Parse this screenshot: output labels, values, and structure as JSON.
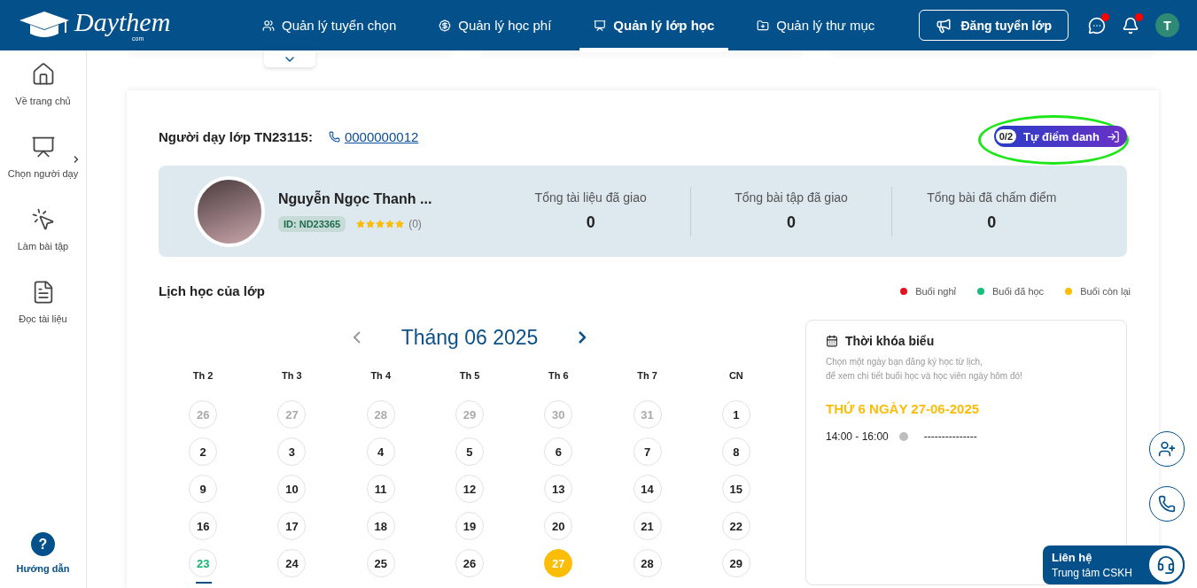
{
  "logo": {
    "name": "Daythem",
    "suffix": "com"
  },
  "nav": [
    {
      "label": "Quản lý tuyển chọn",
      "selected": false
    },
    {
      "label": "Quản lý học phí",
      "selected": false
    },
    {
      "label": "Quản lý lớp học",
      "selected": true
    },
    {
      "label": "Quản lý thư mục",
      "selected": false
    }
  ],
  "post_button": "Đăng tuyển lớp",
  "header_icons": [
    {
      "unread": true
    },
    {
      "unread": true
    }
  ],
  "user_initial": "T",
  "sidebar": {
    "items": [
      {
        "label": "Về trang chủ",
        "expandable": false
      },
      {
        "label": "Chọn người dạy",
        "expandable": true
      },
      {
        "label": "Làm bài tập",
        "expandable": false
      },
      {
        "label": "Đọc tài liệu",
        "expandable": false
      }
    ],
    "help": {
      "mark": "?",
      "label": "Hướng dẫn"
    }
  },
  "class_header": {
    "title": "Người dạy lớp TN23115:",
    "phone": "0000000012",
    "attendance": {
      "count": "0/2",
      "label": "Tự điểm danh",
      "highlighted": true
    }
  },
  "teacher": {
    "name": "Nguyễn Ngọc Thanh ...",
    "id": "ID: ND23365",
    "stars": 5,
    "reviews": "(0)",
    "stats": [
      {
        "label": "Tổng tài liệu đã giao",
        "value": "0"
      },
      {
        "label": "Tổng bài tập đã giao",
        "value": "0"
      },
      {
        "label": "Tổng bài đã chấm điểm",
        "value": "0"
      }
    ]
  },
  "schedule": {
    "title": "Lịch học của lớp",
    "legend": [
      {
        "label": "Buổi nghỉ",
        "color": "#e0161c"
      },
      {
        "label": "Buổi đã học",
        "color": "#12c07a"
      },
      {
        "label": "Buổi còn lại",
        "color": "#fbbd08"
      }
    ],
    "month": "Tháng 06 2025",
    "weekdays": [
      "Th 2",
      "Th 3",
      "Th 4",
      "Th 5",
      "Th 6",
      "Th 7",
      "CN"
    ],
    "days": [
      {
        "label": "26",
        "kind": "outside",
        "selected": false
      },
      {
        "label": "27",
        "kind": "outside",
        "selected": false
      },
      {
        "label": "28",
        "kind": "outside",
        "selected": false
      },
      {
        "label": "29",
        "kind": "outside",
        "selected": false
      },
      {
        "label": "30",
        "kind": "outside",
        "selected": false
      },
      {
        "label": "31",
        "kind": "outside",
        "selected": false
      },
      {
        "label": "1",
        "kind": "normal",
        "selected": false
      },
      {
        "label": "2",
        "kind": "normal",
        "selected": false
      },
      {
        "label": "3",
        "kind": "normal",
        "selected": false
      },
      {
        "label": "4",
        "kind": "normal",
        "selected": false
      },
      {
        "label": "5",
        "kind": "normal",
        "selected": false
      },
      {
        "label": "6",
        "kind": "normal",
        "selected": false
      },
      {
        "label": "7",
        "kind": "normal",
        "selected": false
      },
      {
        "label": "8",
        "kind": "normal",
        "selected": false
      },
      {
        "label": "9",
        "kind": "normal",
        "selected": false
      },
      {
        "label": "10",
        "kind": "normal",
        "selected": false
      },
      {
        "label": "11",
        "kind": "normal",
        "selected": false
      },
      {
        "label": "12",
        "kind": "normal",
        "selected": false
      },
      {
        "label": "13",
        "kind": "normal",
        "selected": false
      },
      {
        "label": "14",
        "kind": "normal",
        "selected": false
      },
      {
        "label": "15",
        "kind": "normal",
        "selected": false
      },
      {
        "label": "16",
        "kind": "normal",
        "selected": false
      },
      {
        "label": "17",
        "kind": "normal",
        "selected": false
      },
      {
        "label": "18",
        "kind": "normal",
        "selected": false
      },
      {
        "label": "19",
        "kind": "normal",
        "selected": false
      },
      {
        "label": "20",
        "kind": "normal",
        "selected": false
      },
      {
        "label": "21",
        "kind": "normal",
        "selected": false
      },
      {
        "label": "22",
        "kind": "normal",
        "selected": false
      },
      {
        "label": "23",
        "kind": "today",
        "selected": false
      },
      {
        "label": "24",
        "kind": "normal",
        "selected": false
      },
      {
        "label": "25",
        "kind": "normal",
        "selected": false
      },
      {
        "label": "26",
        "kind": "normal",
        "selected": false
      },
      {
        "label": "27",
        "kind": "normal",
        "selected": true
      },
      {
        "label": "28",
        "kind": "normal",
        "selected": false
      },
      {
        "label": "29",
        "kind": "normal",
        "selected": false
      }
    ]
  },
  "timetable": {
    "title": "Thời khóa biểu",
    "hint_lines": [
      "Chọn một ngày bạn đăng ký học từ lịch,",
      "để xem chi tiết buổi học và học viên ngày hôm đó!"
    ],
    "date": "THỨ 6 NGÀY 27-06-2025",
    "sessions": [
      {
        "time": "14:00 - 16:00",
        "detail": "---------------"
      }
    ]
  },
  "contact": {
    "title": "Liên hệ",
    "subtitle": "Trung tâm CSKH"
  }
}
